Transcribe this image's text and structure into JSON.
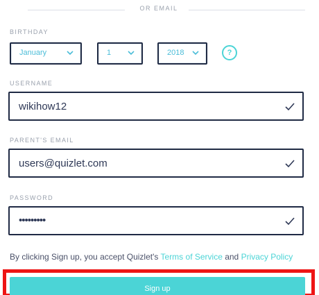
{
  "divider": {
    "text": "OR EMAIL"
  },
  "birthday": {
    "label": "BIRTHDAY",
    "month": "January",
    "day": "1",
    "year": "2018",
    "help_icon": "question-circle-icon",
    "help_glyph": "?"
  },
  "username": {
    "label": "USERNAME",
    "value": "wikihow12"
  },
  "parent_email": {
    "label": "PARENT'S EMAIL",
    "value": "users@quizlet.com"
  },
  "password": {
    "label": "PASSWORD",
    "value": "•••••••••"
  },
  "terms": {
    "prefix": "By clicking Sign up, you accept Quizlet's ",
    "tos_link": "Terms of Service",
    "middle": " and ",
    "privacy_link": "Privacy Policy"
  },
  "signup_button": {
    "label": "Sign up"
  },
  "colors": {
    "accent": "#4bd4d6",
    "border": "#1f2a44",
    "highlight": "#ee1515",
    "muted": "#9aa1ad"
  }
}
